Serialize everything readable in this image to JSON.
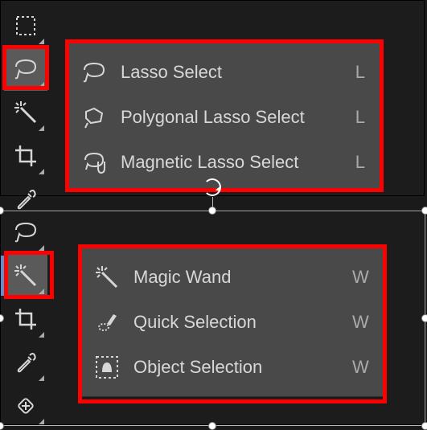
{
  "top": {
    "toolbar": [
      {
        "name": "rectangle-select-tool",
        "icon": "marquee",
        "selected": false
      },
      {
        "name": "lasso-tool",
        "icon": "lasso",
        "selected": true
      },
      {
        "name": "magic-wand-tool",
        "icon": "wand",
        "selected": false
      },
      {
        "name": "crop-tool",
        "icon": "crop",
        "selected": false
      },
      {
        "name": "eyedropper-tool",
        "icon": "eyedropper",
        "selected": false
      }
    ],
    "flyout": [
      {
        "icon": "lasso",
        "label": "Lasso Select",
        "shortcut": "L"
      },
      {
        "icon": "polygonal",
        "label": "Polygonal Lasso Select",
        "shortcut": "L"
      },
      {
        "icon": "magnetic",
        "label": "Magnetic Lasso Select",
        "shortcut": "L"
      }
    ]
  },
  "bottom": {
    "toolbar": [
      {
        "name": "lasso-tool",
        "icon": "lasso",
        "selected": false
      },
      {
        "name": "magic-wand-tool",
        "icon": "wand",
        "selected": true
      },
      {
        "name": "crop-tool",
        "icon": "crop",
        "selected": false
      },
      {
        "name": "eyedropper-tool",
        "icon": "eyedropper",
        "selected": false
      },
      {
        "name": "heal-tool",
        "icon": "heal",
        "selected": false
      }
    ],
    "flyout": [
      {
        "icon": "wand",
        "label": "Magic Wand",
        "shortcut": "W"
      },
      {
        "icon": "quicksel",
        "label": "Quick Selection",
        "shortcut": "W"
      },
      {
        "icon": "objectsel",
        "label": "Object Selection",
        "shortcut": "W"
      }
    ]
  }
}
